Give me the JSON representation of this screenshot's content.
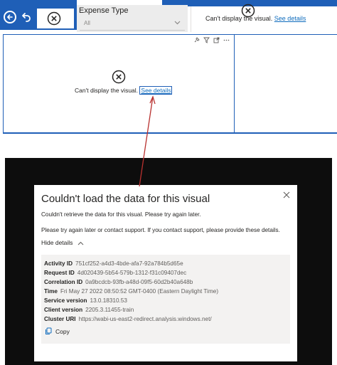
{
  "slicer": {
    "title": "Expense Type",
    "value": "All"
  },
  "top_visual": {
    "message": "Can't display the visual.",
    "link": "See details"
  },
  "main_visual": {
    "message": "Can't display the visual.",
    "link": "See details"
  },
  "dialog": {
    "title": "Couldn't load the data for this visual",
    "message": "Couldn't retrieve the data for this visual. Please try again later.",
    "support_message": "Please try again later or contact support. If you contact support, please provide these details.",
    "hide_details": "Hide details",
    "details": [
      {
        "label": "Activity ID",
        "value": "751cf252-a4d3-4bde-afa7-92a784b5d65e"
      },
      {
        "label": "Request ID",
        "value": "4d020439-5b54-579b-1312-f31c09407dec"
      },
      {
        "label": "Correlation ID",
        "value": "0a9bcdcb-93fb-a48d-09f5-60d2b40a648b"
      },
      {
        "label": "Time",
        "value": "Fri May 27 2022 08:50:52 GMT-0400 (Eastern Daylight Time)"
      },
      {
        "label": "Service version",
        "value": "13.0.18310.53"
      },
      {
        "label": "Client version",
        "value": "2205.3.11455-train"
      },
      {
        "label": "Cluster URI",
        "value": "https://wabi-us-east2-redirect.analysis.windows.net/"
      }
    ],
    "copy_label": "Copy"
  },
  "colors": {
    "header_blue": "#1f5fb7",
    "link_blue": "#0f6cbd",
    "arrow_red": "#b8312f",
    "backdrop": "#0d0d0d",
    "details_bg": "#f3f2f1"
  },
  "icons": [
    "back-icon",
    "undo-icon",
    "error-circle-icon",
    "pin-icon",
    "filter-icon",
    "focus-mode-icon",
    "more-options-icon",
    "chevron-down-icon",
    "close-icon",
    "chevron-up-icon",
    "copy-icon"
  ]
}
